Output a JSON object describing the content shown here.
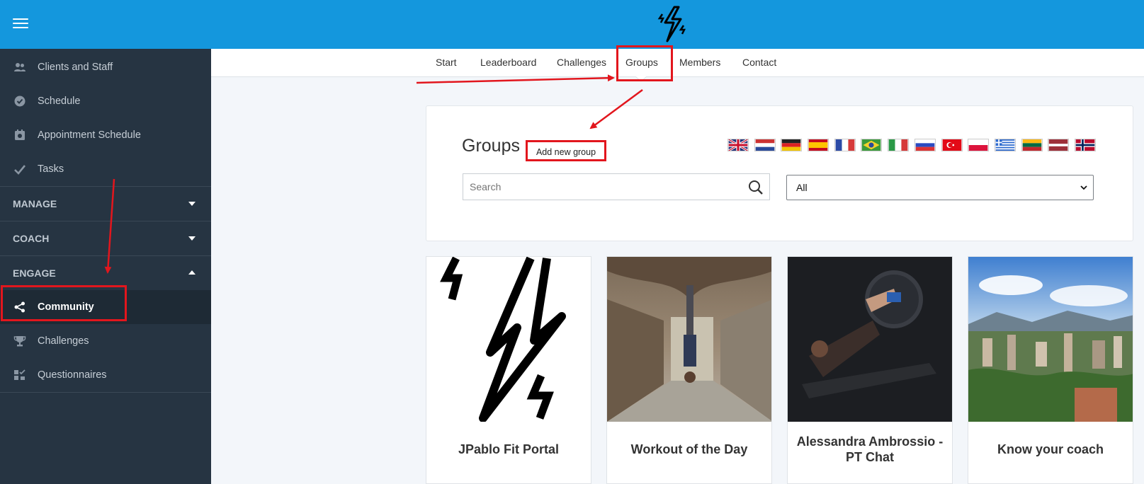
{
  "colors": {
    "topbar": "#1497dd",
    "sidebar": "#263442",
    "annotation": "#e2161d"
  },
  "header": {
    "menu_icon": "hamburger-icon",
    "logo_icon": "lightning-logo-icon"
  },
  "sidebar": {
    "items_top": [
      {
        "label": "Clients and Staff",
        "icon": "people-icon"
      },
      {
        "label": "Schedule",
        "icon": "clock-check-icon"
      },
      {
        "label": "Appointment Schedule",
        "icon": "calendar-icon"
      },
      {
        "label": "Tasks",
        "icon": "checkmark-icon"
      }
    ],
    "sections": [
      {
        "label": "MANAGE",
        "state": "collapsed"
      },
      {
        "label": "COACH",
        "state": "collapsed"
      },
      {
        "label": "ENGAGE",
        "state": "expanded"
      }
    ],
    "engage_items": [
      {
        "label": "Community",
        "icon": "share-icon",
        "active": true
      },
      {
        "label": "Challenges",
        "icon": "trophy-icon"
      },
      {
        "label": "Questionnaires",
        "icon": "checklist-icon"
      }
    ]
  },
  "nav": {
    "tabs": [
      "Start",
      "Leaderboard",
      "Challenges",
      "Groups",
      "Members",
      "Contact"
    ],
    "active": "Groups"
  },
  "groups": {
    "title": "Groups",
    "add_button": "Add new group",
    "flags": [
      "uk-flag-icon",
      "netherlands-flag-icon",
      "germany-flag-icon",
      "spain-flag-icon",
      "france-flag-icon",
      "brazil-flag-icon",
      "italy-flag-icon",
      "russia-flag-icon",
      "turkey-flag-icon",
      "poland-flag-icon",
      "greece-flag-icon",
      "lithuania-flag-icon",
      "latvia-flag-icon",
      "norway-flag-icon"
    ],
    "search_placeholder": "Search",
    "filter_value": "All",
    "cards": [
      {
        "title": "JPablo Fit Portal",
        "image": "lightning-bolt-logo"
      },
      {
        "title": "Workout of the Day",
        "image": "handstand-photo"
      },
      {
        "title": "Alessandra Ambrossio - PT Chat",
        "image": "leg-press-photo"
      },
      {
        "title": "Know your coach",
        "image": "city-landscape-photo"
      }
    ]
  }
}
